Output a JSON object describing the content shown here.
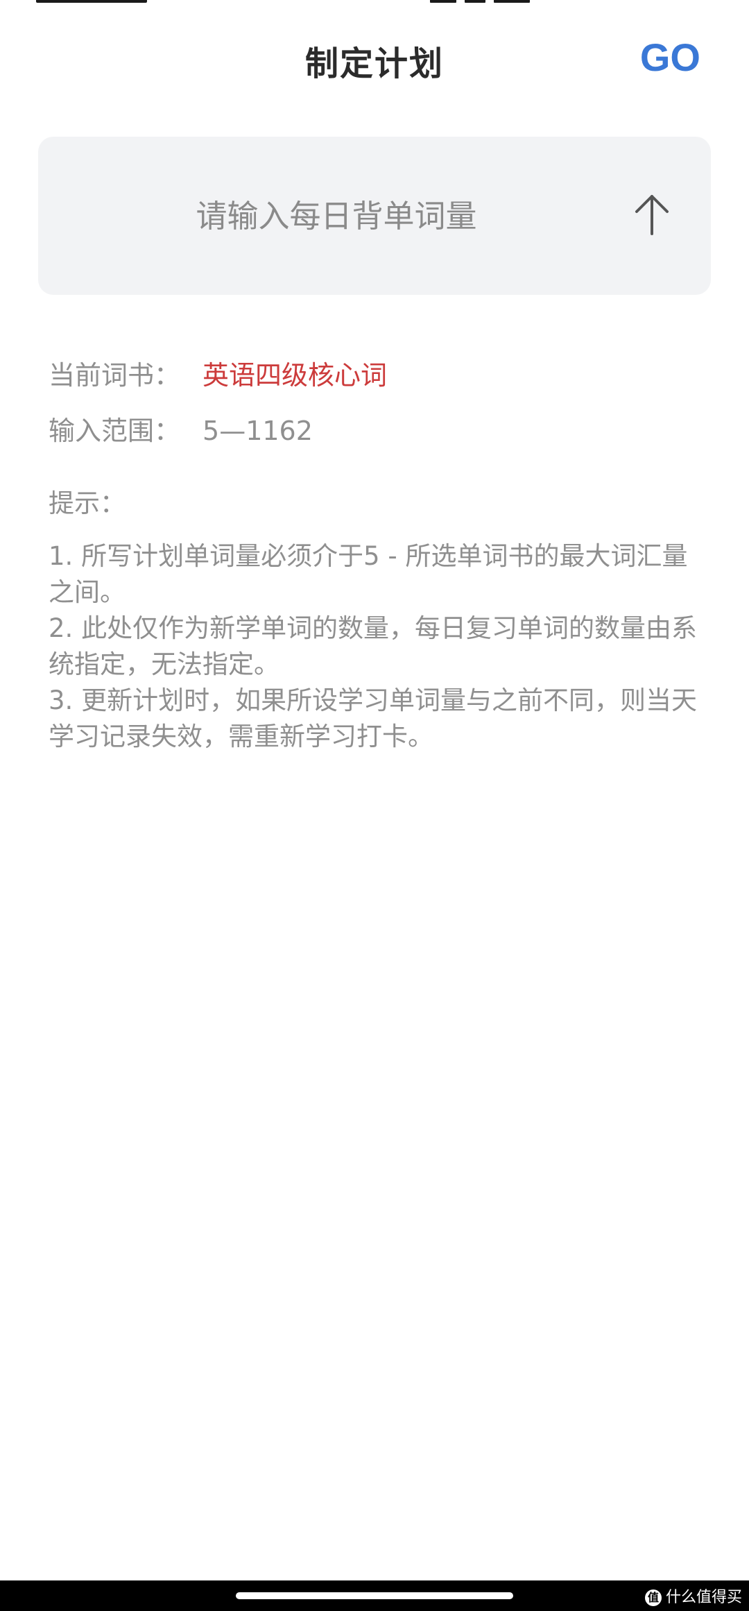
{
  "header": {
    "title": "制定计划",
    "go_label": "GO"
  },
  "input": {
    "placeholder": "请输入每日背单词量"
  },
  "info": {
    "book_label": "当前词书：",
    "book_value": "英语四级核心词",
    "range_label": "输入范围：",
    "range_value": "5—1162"
  },
  "tips": {
    "title": "提示：",
    "items": [
      "1. 所写计划单词量必须介于5 - 所选单词书的最大词汇量之间。",
      "2. 此处仅作为新学单词的数量，每日复习单词的数量由系统指定，无法指定。",
      "3. 更新计划时，如果所设学习单词量与之前不同，则当天学习记录失效，需重新学习打卡。"
    ]
  },
  "watermark": {
    "text": "什么值得买",
    "icon_char": "值"
  },
  "colors": {
    "accent": "#3a78d6",
    "book_highlight": "#cc3b3b",
    "muted_text": "#8f8f8f",
    "card_bg": "#f2f3f5"
  }
}
